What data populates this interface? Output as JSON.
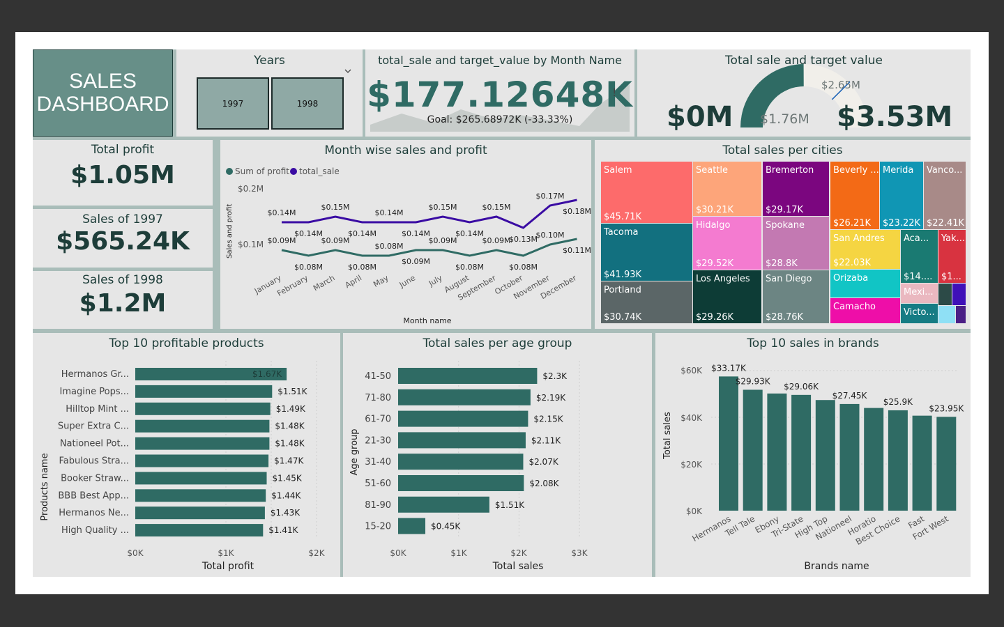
{
  "header": {
    "title_line1": "SALES",
    "title_line2": "DASHBOARD"
  },
  "years_slicer": {
    "title": "Years",
    "options": [
      "1997",
      "1998"
    ],
    "chevron_icon": "chevron-down-icon"
  },
  "kpi_month": {
    "title": "total_sale and target_value by Month Name",
    "value": "$177.12648K",
    "indicator": "!",
    "goal": "Goal: $265.68972K (-33.33%)"
  },
  "gauge": {
    "title": "Total sale and target value",
    "min_label": "$0M",
    "max_label": "$3.53M",
    "value_label": "$1.76M",
    "target_label": "$2.65M",
    "value": 1.76,
    "target": 2.65,
    "min": 0,
    "max": 3.53,
    "colors": {
      "fill": "#2f6b64",
      "track": "#f1efea"
    }
  },
  "cards": {
    "total_profit": {
      "title": "Total profit",
      "value": "$1.05M"
    },
    "sales_1997": {
      "title": "Sales of 1997",
      "value": "$565.24K"
    },
    "sales_1998": {
      "title": "Sales of 1998",
      "value": "$1.2M"
    }
  },
  "month_chart": {
    "title": "Month wise sales and profit",
    "legend": [
      "Sum of profit",
      "total_sale"
    ],
    "colors": {
      "profit": "#2f6b64",
      "sale": "#3a0ca3"
    },
    "y_ticks": [
      "$0.2M",
      "$0.1M"
    ],
    "ylabel": "Sales and profit",
    "xlabel": "Month name"
  },
  "city_chart": {
    "title": "Total sales per cities",
    "tiles": [
      {
        "name": "Salem",
        "value": "$45.71K",
        "color": "#fd6b6b"
      },
      {
        "name": "Tacoma",
        "value": "$41.93K",
        "color": "#12707f"
      },
      {
        "name": "Portland",
        "value": "$30.74K",
        "color": "#5b6667"
      },
      {
        "name": "Seattle",
        "value": "$30.21K",
        "color": "#fda57a"
      },
      {
        "name": "Hidalgo",
        "value": "$29.52K",
        "color": "#f47bd0"
      },
      {
        "name": "Los Angeles",
        "value": "$29.26K",
        "color": "#0d3c36"
      },
      {
        "name": "Bremerton",
        "value": "$29.17K",
        "color": "#7b067f"
      },
      {
        "name": "Spokane",
        "value": "$28.8K",
        "color": "#c379b2"
      },
      {
        "name": "San Diego",
        "value": "$28.76K",
        "color": "#6c8583"
      },
      {
        "name": "Beverly ...",
        "value": "$26.21K",
        "color": "#f36a16"
      },
      {
        "name": "Merida",
        "value": "$23.22K",
        "color": "#1096b4"
      },
      {
        "name": "Vanco...",
        "value": "$22.41K",
        "color": "#a88a88"
      },
      {
        "name": "San Andres",
        "value": "$22.03K",
        "color": "#f5d542"
      },
      {
        "name": "Orizaba",
        "value": "",
        "color": "#11c5c5"
      },
      {
        "name": "Camacho",
        "value": "",
        "color": "#ee0ea8"
      },
      {
        "name": "Aca...",
        "value": "$14....",
        "color": "#1a7a72"
      },
      {
        "name": "Yak...",
        "value": "$1...",
        "color": "#d83340"
      },
      {
        "name": "Mexi...",
        "value": "",
        "color": "#eab8c0"
      },
      {
        "name": "Victo...",
        "value": "",
        "color": "#167c84"
      }
    ],
    "small_tile_colors": [
      "#2c4a47",
      "#3f10b8",
      "#8fe0f5",
      "#4b1f86"
    ]
  },
  "products_chart": {
    "title": "Top 10 profitable products",
    "xlabel": "Total profit",
    "ylabel": "Products name",
    "x_ticks": [
      "$0K",
      "$1K",
      "$2K"
    ],
    "bar_color": "#2f6b64"
  },
  "age_chart": {
    "title": "Total sales per age group",
    "xlabel": "Total sales",
    "ylabel": "Age group",
    "x_ticks": [
      "$0K",
      "$1K",
      "$2K",
      "$3K"
    ],
    "bar_color": "#2f6b64"
  },
  "brands_chart": {
    "title": "Top 10 sales in brands",
    "xlabel": "Brands name",
    "ylabel": "Total sales",
    "y_ticks": [
      "$60K",
      "$40K",
      "$20K",
      "$0K"
    ],
    "bar_color": "#2f6b64"
  },
  "chart_data": [
    {
      "type": "line",
      "title": "Month wise sales and profit",
      "xlabel": "Month name",
      "ylabel": "Sales and profit",
      "categories": [
        "January",
        "February",
        "March",
        "April",
        "May",
        "June",
        "July",
        "August",
        "September",
        "October",
        "November",
        "December"
      ],
      "series": [
        {
          "name": "total_sale",
          "values": [
            0.14,
            0.14,
            0.15,
            0.14,
            0.14,
            0.14,
            0.15,
            0.14,
            0.15,
            0.13,
            0.17,
            0.18
          ],
          "labels": [
            "$0.14M",
            "$0.14M",
            "$0.15M",
            "$0.14M",
            "$0.14M",
            "$0.14M",
            "$0.15M",
            "$0.14M",
            "$0.15M",
            "$0.13M",
            "$0.17M",
            "$0.18M"
          ]
        },
        {
          "name": "Sum of profit",
          "values": [
            0.09,
            0.08,
            0.09,
            0.08,
            0.08,
            0.09,
            0.09,
            0.08,
            0.09,
            0.08,
            0.1,
            0.11
          ],
          "labels": [
            "$0.09M",
            "$0.08M",
            "$0.09M",
            "$0.08M",
            "$0.08M",
            "$0.09M",
            "$0.09M",
            "$0.08M",
            "$0.09M",
            "$0.08M",
            "$0.10M",
            "$0.11M"
          ]
        }
      ],
      "ylim": [
        0.0,
        0.2
      ]
    },
    {
      "type": "bar",
      "title": "Top 10 profitable products",
      "xlabel": "Total profit",
      "ylabel": "Products name",
      "categories": [
        "Hermanos Gr...",
        "Imagine Pops...",
        "Hilltop Mint ...",
        "Super Extra C...",
        "Nationeel Pot...",
        "Fabulous Stra...",
        "Booker Straw...",
        "BBB Best App...",
        "Hermanos Ne...",
        "High Quality ..."
      ],
      "values": [
        1.67,
        1.51,
        1.49,
        1.48,
        1.48,
        1.47,
        1.45,
        1.44,
        1.43,
        1.41
      ],
      "labels": [
        "$1.67K",
        "$1.51K",
        "$1.49K",
        "$1.48K",
        "$1.48K",
        "$1.47K",
        "$1.45K",
        "$1.44K",
        "$1.43K",
        "$1.41K"
      ],
      "xlim": [
        0,
        2
      ]
    },
    {
      "type": "bar",
      "title": "Total sales per age group",
      "xlabel": "Total sales",
      "ylabel": "Age group",
      "categories": [
        "41-50",
        "71-80",
        "61-70",
        "21-30",
        "31-40",
        "51-60",
        "81-90",
        "15-20"
      ],
      "values": [
        2.3,
        2.19,
        2.15,
        2.11,
        2.07,
        2.08,
        1.51,
        0.45
      ],
      "labels": [
        "$2.3K",
        "$2.19K",
        "$2.15K",
        "$2.11K",
        "$2.07K",
        "$2.08K",
        "$1.51K",
        "$0.45K"
      ],
      "xlim": [
        0,
        3
      ]
    },
    {
      "type": "bar",
      "title": "Top 10 sales in brands",
      "xlabel": "Brands name",
      "ylabel": "Total sales",
      "categories": [
        "Hermanos",
        "Tell Tale",
        "Ebony",
        "Tri-State",
        "High Top",
        "Nationeel",
        "Horatio",
        "Best Choice",
        "Fast",
        "Fort West"
      ],
      "values": [
        57.5,
        51.8,
        50.2,
        49.6,
        47.4,
        45.7,
        44.0,
        43.0,
        40.7,
        40.2
      ],
      "labels": [
        "$33.17K",
        "$29.93K",
        "",
        "$29.06K",
        "",
        "$27.45K",
        "",
        "$25.9K",
        "",
        "$23.95K"
      ],
      "ylim": [
        0,
        60
      ]
    }
  ]
}
